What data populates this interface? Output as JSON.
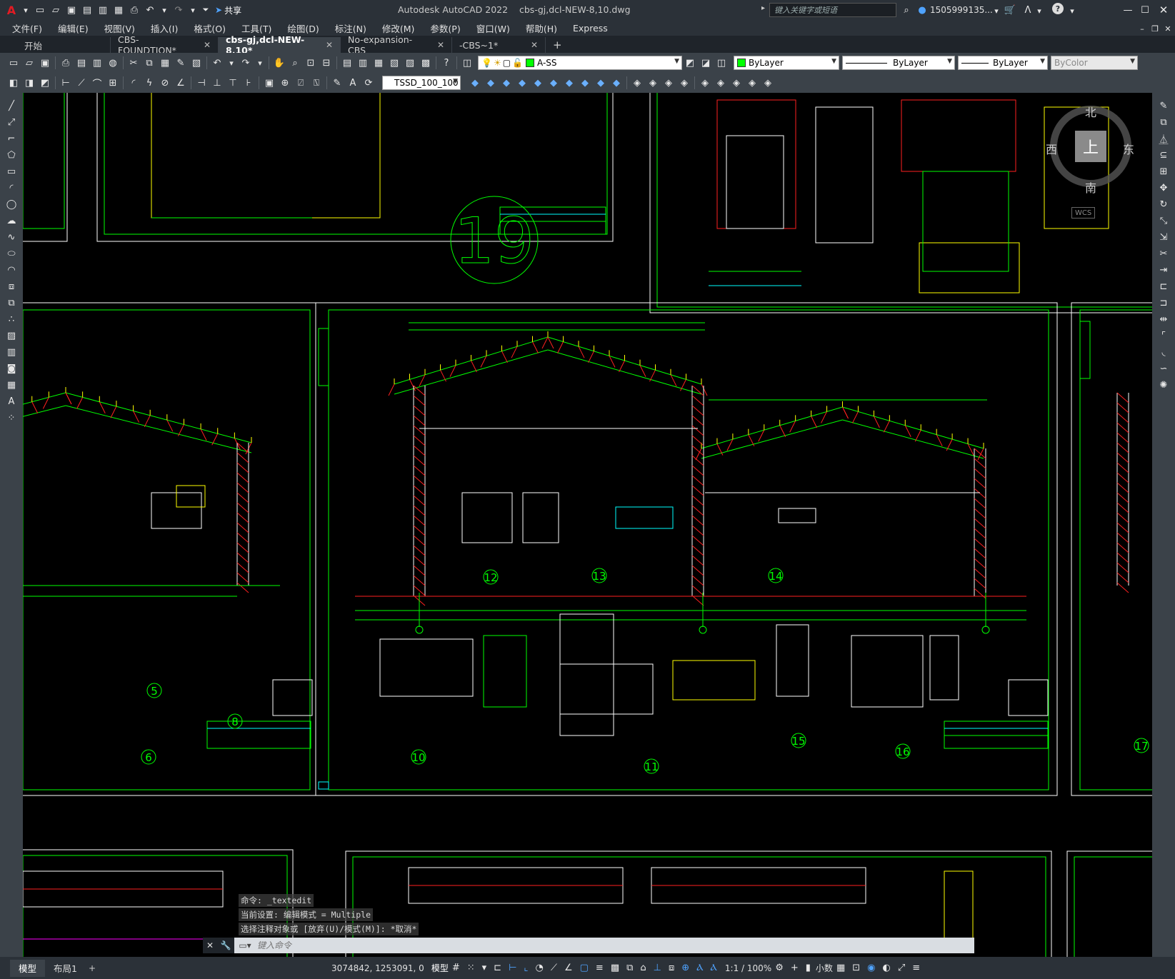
{
  "title_bar": {
    "app_title": "Autodesk AutoCAD 2022",
    "file_name": "cbs-gj,dcl-NEW-8,10.dwg",
    "share_label": "共享",
    "search_placeholder": "键入关键字或短语",
    "user_name": "1505999135...",
    "help_label": "?"
  },
  "menu": [
    "文件(F)",
    "编辑(E)",
    "视图(V)",
    "插入(I)",
    "格式(O)",
    "工具(T)",
    "绘图(D)",
    "标注(N)",
    "修改(M)",
    "参数(P)",
    "窗口(W)",
    "帮助(H)",
    "Express"
  ],
  "tabs": [
    {
      "label": "开始",
      "closable": false,
      "active": false
    },
    {
      "label": "CBS-FOUNDTION*",
      "closable": true,
      "active": false
    },
    {
      "label": "cbs-gj,dcl-NEW-8,10*",
      "closable": true,
      "active": true
    },
    {
      "label": "No-expansion-CBS",
      "closable": true,
      "active": false
    },
    {
      "label": "-CBS~1*",
      "closable": true,
      "active": false
    }
  ],
  "toolbar": {
    "layer_name": "A-SS",
    "color": "ByLayer",
    "linetype": "ByLayer",
    "lineweight": "ByLayer",
    "plotstyle": "ByColor",
    "text_style": "TSSD_100_100"
  },
  "viewcube": {
    "north": "北",
    "south": "南",
    "east": "东",
    "west": "西",
    "top": "上",
    "wcs": "WCS"
  },
  "drawing_labels": {
    "sheet_number": "19",
    "detail_12": "12",
    "detail_13": "13",
    "detail_14": "14",
    "detail_5": "5",
    "detail_6": "6",
    "detail_8": "8",
    "detail_10": "10",
    "detail_11": "11",
    "detail_15": "15",
    "detail_16": "16",
    "detail_17": "17"
  },
  "command_history": [
    "命令: _textedit",
    "当前设置: 编辑模式 = Multiple",
    "选择注释对象或 [放弃(U)/模式(M)]: *取消*"
  ],
  "command_placeholder": "键入命令",
  "status": {
    "coordinates": "3074842, 1253091, 0",
    "model_label": "模型",
    "scale": "1:1 / 100%",
    "units": "小数"
  },
  "layout_tabs": [
    "模型",
    "布局1"
  ],
  "colors": {
    "background": "#000000",
    "line_green": "#00ff00",
    "line_red": "#ff2020",
    "line_yellow": "#ffff00",
    "line_white": "#ffffff",
    "line_cyan": "#00ffff",
    "chrome": "#2b3138",
    "toolbar": "#3b4249"
  }
}
